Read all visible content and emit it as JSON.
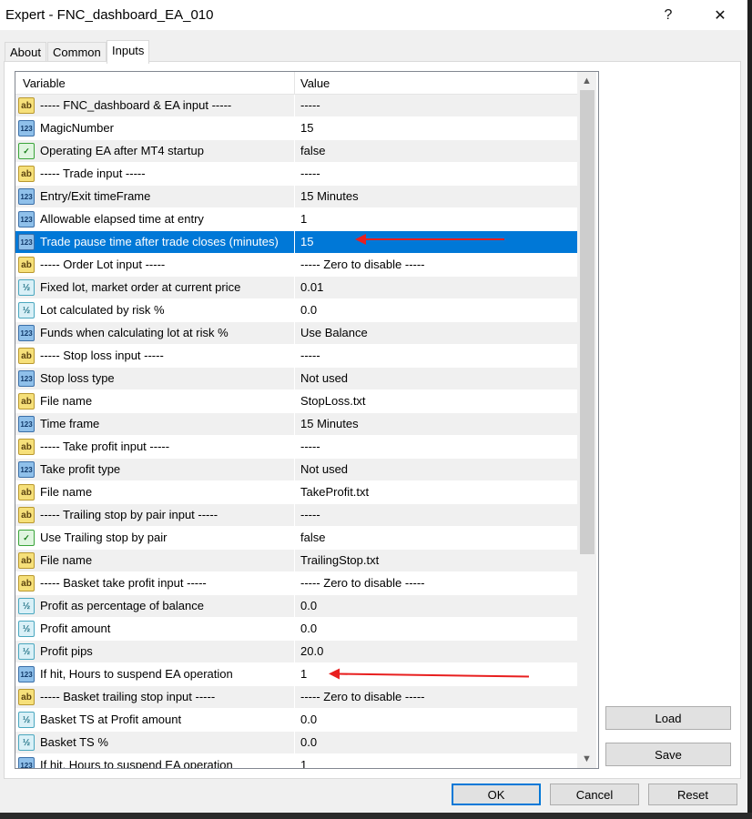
{
  "window": {
    "title": "Expert - FNC_dashboard_EA_010",
    "help_label": "?",
    "close_label": "✕"
  },
  "tabs": [
    {
      "label": "About",
      "active": false
    },
    {
      "label": "Common",
      "active": false
    },
    {
      "label": "Inputs",
      "active": true
    }
  ],
  "grid": {
    "headers": {
      "variable": "Variable",
      "value": "Value"
    },
    "rows": [
      {
        "icon": "ab",
        "variable": "----- FNC_dashboard & EA input -----",
        "value": "-----"
      },
      {
        "icon": "123",
        "variable": "MagicNumber",
        "value": "15"
      },
      {
        "icon": "bool",
        "variable": "Operating EA after MT4 startup",
        "value": "false"
      },
      {
        "icon": "ab",
        "variable": "----- Trade input -----",
        "value": "-----"
      },
      {
        "icon": "123",
        "variable": "Entry/Exit timeFrame",
        "value": "15 Minutes"
      },
      {
        "icon": "123",
        "variable": "Allowable elapsed time at entry",
        "value": "1"
      },
      {
        "icon": "123",
        "variable": "Trade pause time after trade closes (minutes)",
        "value": "15",
        "selected": true
      },
      {
        "icon": "ab",
        "variable": "----- Order Lot input -----",
        "value": "----- Zero to disable -----"
      },
      {
        "icon": "frac",
        "variable": "Fixed lot, market order at current price",
        "value": "0.01"
      },
      {
        "icon": "frac",
        "variable": "Lot calculated by risk %",
        "value": "0.0"
      },
      {
        "icon": "123",
        "variable": "Funds when calculating lot at risk %",
        "value": "Use Balance"
      },
      {
        "icon": "ab",
        "variable": "----- Stop loss input -----",
        "value": "-----"
      },
      {
        "icon": "123",
        "variable": "Stop loss type",
        "value": "Not used"
      },
      {
        "icon": "ab",
        "variable": "File name",
        "value": "StopLoss.txt"
      },
      {
        "icon": "123",
        "variable": "Time frame",
        "value": "15 Minutes"
      },
      {
        "icon": "ab",
        "variable": "----- Take profit input -----",
        "value": "-----"
      },
      {
        "icon": "123",
        "variable": "Take profit type",
        "value": "Not used"
      },
      {
        "icon": "ab",
        "variable": "File name",
        "value": "TakeProfit.txt"
      },
      {
        "icon": "ab",
        "variable": "----- Trailing stop by pair input -----",
        "value": "-----"
      },
      {
        "icon": "bool",
        "variable": "Use Trailing stop by pair",
        "value": "false"
      },
      {
        "icon": "ab",
        "variable": "File name",
        "value": "TrailingStop.txt"
      },
      {
        "icon": "ab",
        "variable": "----- Basket take profit input -----",
        "value": "----- Zero to disable -----"
      },
      {
        "icon": "frac",
        "variable": "Profit as percentage of balance",
        "value": "0.0"
      },
      {
        "icon": "frac",
        "variable": "Profit amount",
        "value": "0.0"
      },
      {
        "icon": "frac",
        "variable": "Profit pips",
        "value": "20.0"
      },
      {
        "icon": "123",
        "variable": "If hit, Hours to suspend EA operation",
        "value": "1"
      },
      {
        "icon": "ab",
        "variable": "----- Basket trailing stop input -----",
        "value": "----- Zero to disable -----"
      },
      {
        "icon": "frac",
        "variable": "Basket TS at Profit amount",
        "value": "0.0"
      },
      {
        "icon": "frac",
        "variable": "Basket TS %",
        "value": "0.0"
      },
      {
        "icon": "123",
        "variable": "If hit, Hours to suspend EA operation",
        "value": "1"
      }
    ]
  },
  "side_buttons": {
    "load": "Load",
    "save": "Save"
  },
  "footer_buttons": {
    "ok": "OK",
    "cancel": "Cancel",
    "reset": "Reset"
  },
  "colors": {
    "selection": "#0078d7",
    "annotation_arrow": "#e81f1f"
  }
}
